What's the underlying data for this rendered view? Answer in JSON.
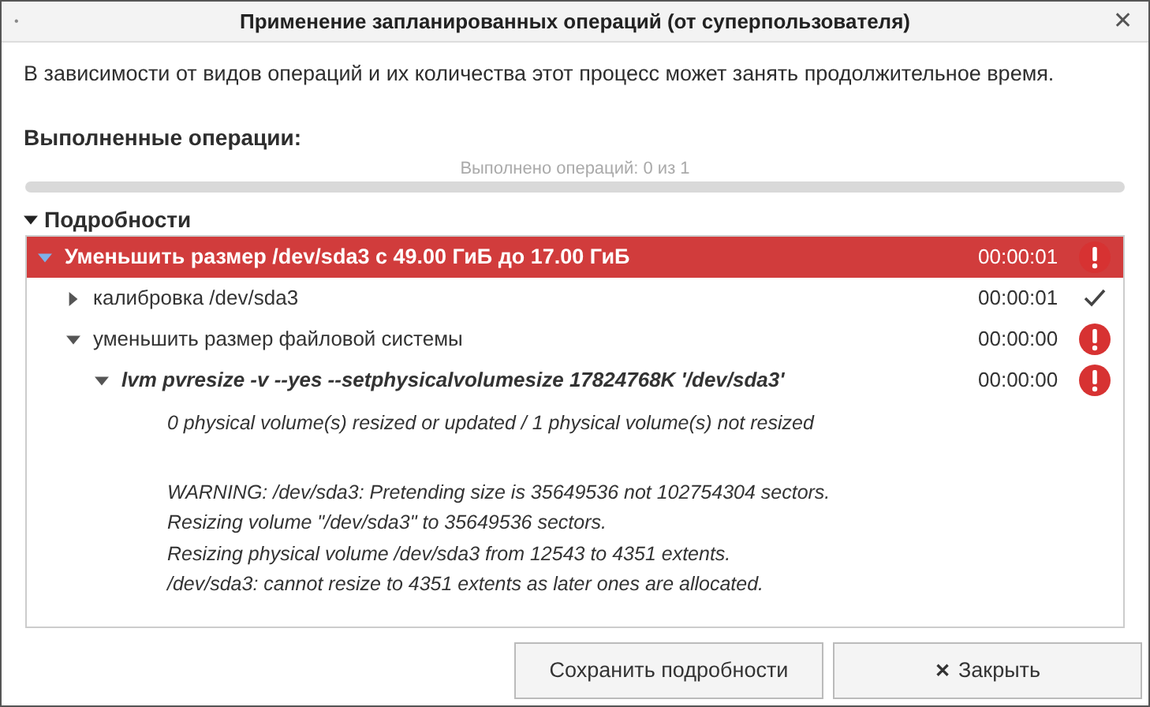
{
  "window": {
    "title": "Применение запланированных операций (от суперпользователя)",
    "menu_glyph": "•",
    "close_glyph": "✕"
  },
  "intro": "В зависимости от видов операций и их количества этот процесс может занять продолжительное время.",
  "completed_heading": "Выполненные операции:",
  "progress": {
    "label": "Выполнено операций: 0 из 1",
    "level": 0
  },
  "details": {
    "label": "Подробности",
    "expanded": true
  },
  "operations": [
    {
      "text": "Уменьшить размер /dev/sda3 с 49.00 ГиБ до 17.00 ГиБ",
      "time": "00:00:01",
      "failed": true,
      "expanded": true,
      "selected": true,
      "children": [
        {
          "text": "калибровка /dev/sda3",
          "time": "00:00:01",
          "failed": false,
          "expanded": false,
          "selected": false
        },
        {
          "text": "уменьшить размер файловой системы",
          "time": "00:00:00",
          "failed": true,
          "expanded": true,
          "selected": false,
          "children": [
            {
              "text": "lvm pvresize -v  --yes --setphysicalvolumesize 17824768K '/dev/sda3'",
              "kind": "command",
              "time": "00:00:00",
              "failed": true,
              "expanded": true,
              "selected": false,
              "output": [
                [
                  "0 physical volume(s) resized or updated / 1 physical volume(s) not resized"
                ],
                [
                  "WARNING: /dev/sda3: Pretending size is 35649536 not 102754304 sectors.",
                  "Resizing volume \"/dev/sda3\" to 35649536 sectors.",
                  "Resizing physical volume /dev/sda3 from 12543 to 4351 extents.",
                  "/dev/sda3: cannot resize to 4351 extents as later ones are allocated."
                ]
              ]
            }
          ]
        }
      ]
    }
  ],
  "buttons": [
    {
      "label": "Сохранить подробности"
    },
    {
      "label": "Закрыть",
      "glyph": "✕"
    }
  ]
}
